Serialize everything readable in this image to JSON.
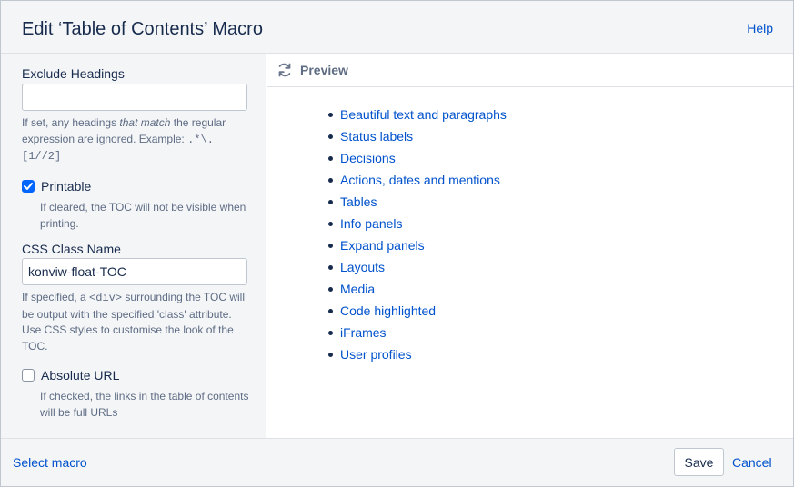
{
  "header": {
    "title": "Edit ‘Table of Contents’ Macro",
    "help_label": "Help"
  },
  "params": {
    "exclude_headings": {
      "label": "Exclude Headings",
      "value": "",
      "desc_pre": "If set, any headings ",
      "desc_em": "that match",
      "desc_mid": " the regular expression are ignored. Example: ",
      "desc_code": ".*\\.[1//2]"
    },
    "printable": {
      "label": "Printable",
      "checked": true,
      "desc": "If cleared, the TOC will not be visible when printing."
    },
    "css_class": {
      "label": "CSS Class Name",
      "value": "konviw-float-TOC",
      "desc_pre": "If specified, a ",
      "desc_code": "<div>",
      "desc_post": " surrounding the TOC will be output with the specified 'class' attribute. Use CSS styles to customise the look of the TOC."
    },
    "absolute_url": {
      "label": "Absolute URL",
      "checked": false,
      "desc": "If checked, the links in the table of contents will be full URLs"
    }
  },
  "preview": {
    "label": "Preview",
    "refresh_icon": "refresh-icon",
    "toc_items": [
      "Beautiful text and paragraphs",
      "Status labels",
      "Decisions",
      "Actions, dates and mentions",
      "Tables",
      "Info panels",
      "Expand panels",
      "Layouts",
      "Media",
      "Code highlighted",
      "iFrames",
      "User profiles"
    ]
  },
  "footer": {
    "select_macro_label": "Select macro",
    "save_label": "Save",
    "cancel_label": "Cancel"
  },
  "colors": {
    "link": "#0052cc",
    "checkbox_checked": "#0065ff",
    "panel_bg": "#f4f5f7",
    "text": "#172b4d",
    "subtle_text": "#5e6c84"
  }
}
